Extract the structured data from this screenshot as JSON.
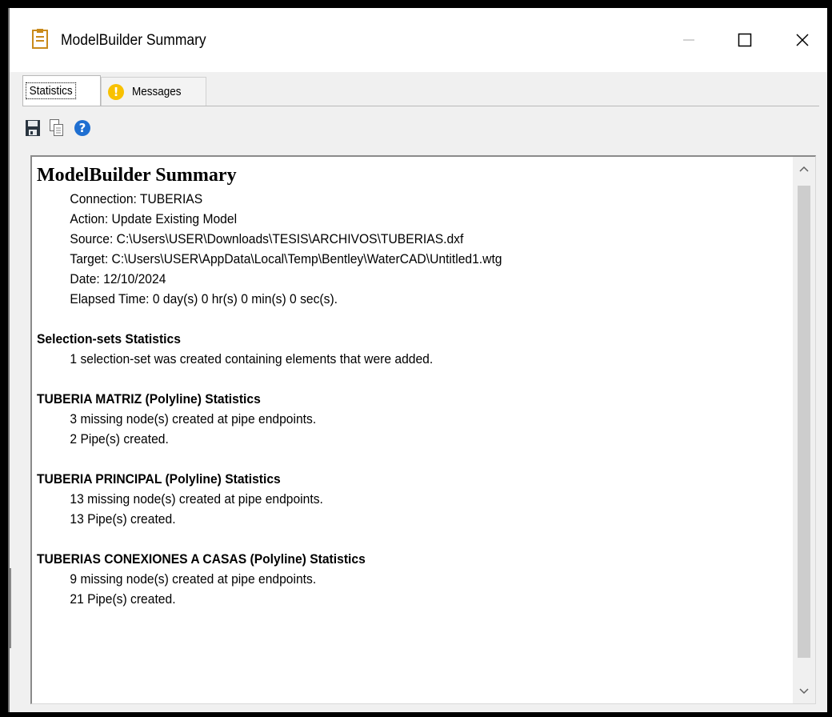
{
  "window": {
    "title": "ModelBuilder Summary"
  },
  "tabs": {
    "statistics": "Statistics",
    "messages": "Messages",
    "messages_icon": "!"
  },
  "toolbar": {
    "items": [
      "save-icon",
      "copy-icon",
      "help-icon"
    ]
  },
  "report": {
    "heading": "ModelBuilder Summary",
    "info": [
      "Connection: TUBERIAS",
      "Action: Update Existing Model",
      "Source: C:\\Users\\USER\\Downloads\\TESIS\\ARCHIVOS\\TUBERIAS.dxf",
      "Target: C:\\Users\\USER\\AppData\\Local\\Temp\\Bentley\\WaterCAD\\Untitled1.wtg",
      "Date: 12/10/2024",
      "Elapsed Time: 0 day(s) 0 hr(s) 0 min(s) 0 sec(s)."
    ],
    "sections": [
      {
        "title": "Selection-sets Statistics",
        "lines": [
          "1 selection-set was created containing elements that were added."
        ]
      },
      {
        "title": "TUBERIA MATRIZ (Polyline) Statistics",
        "lines": [
          "3 missing node(s) created at pipe endpoints.",
          "2 Pipe(s) created."
        ]
      },
      {
        "title": "TUBERIA PRINCIPAL (Polyline) Statistics",
        "lines": [
          "13 missing node(s) created at pipe endpoints.",
          "13 Pipe(s) created."
        ]
      },
      {
        "title": "TUBERIAS CONEXIONES A CASAS (Polyline) Statistics",
        "lines": [
          "9 missing node(s) created at pipe endpoints.",
          "21 Pipe(s) created."
        ]
      }
    ]
  },
  "colors": {
    "warning": "#f8c100",
    "help": "#1f6fd1",
    "scroll_thumb": "#cdcdcd"
  }
}
